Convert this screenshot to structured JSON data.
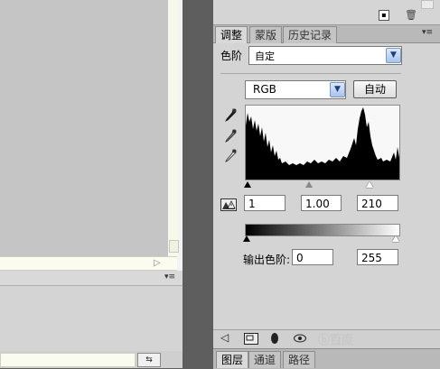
{
  "panel": {
    "tabs": [
      {
        "label": "调整",
        "active": true
      },
      {
        "label": "蒙版",
        "active": false
      },
      {
        "label": "历史记录",
        "active": false
      }
    ],
    "menu_icon": "panel-menu-icon",
    "preset_label": "色阶",
    "preset_value": "自定",
    "channel_value": "RGB",
    "auto_label": "自动",
    "input_black": "1",
    "input_gamma": "1.00",
    "input_white": "210",
    "output_label": "输出色阶:",
    "output_black": "0",
    "output_white": "255",
    "bottom_tabs": [
      {
        "label": "图层",
        "active": true
      },
      {
        "label": "通道",
        "active": false
      },
      {
        "label": "路径",
        "active": false
      }
    ],
    "watermark": "ⓑ百度"
  },
  "colors": {
    "dropdown_accent": "#7d97c7",
    "histogram_bg": "#f8f8f8",
    "panel_bg": "#d4d4d4"
  }
}
